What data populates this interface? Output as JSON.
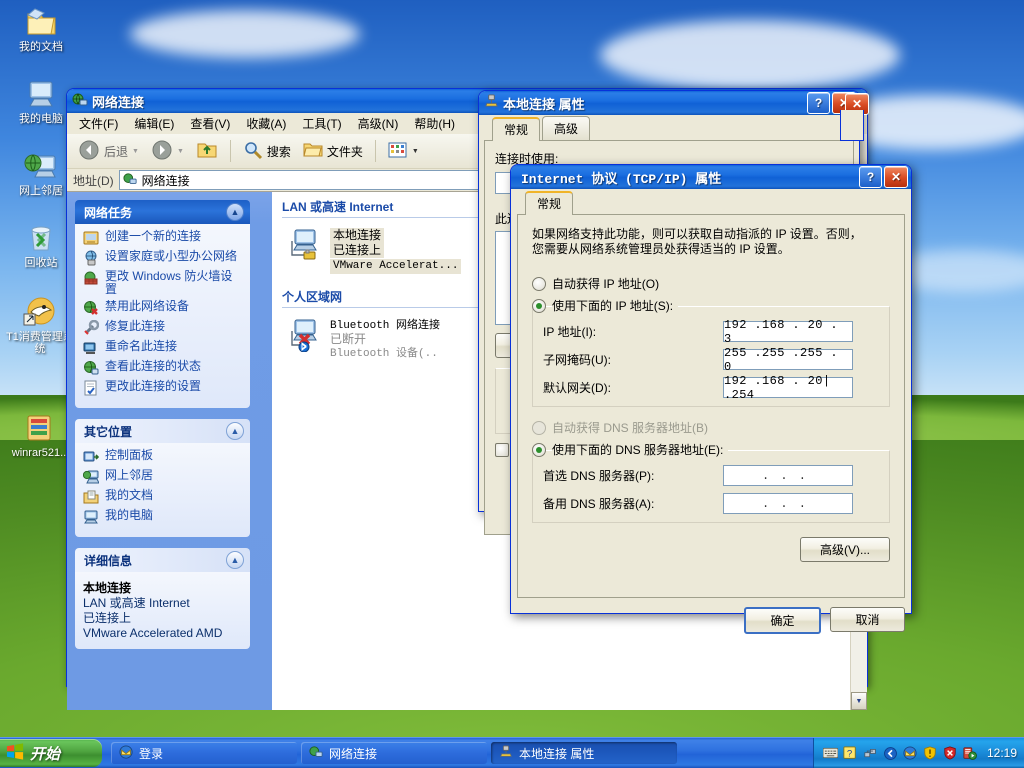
{
  "desktop": {
    "icons": [
      {
        "label": "我的文档",
        "icon": "my-documents-icon"
      },
      {
        "label": "我的电脑",
        "icon": "my-computer-icon"
      },
      {
        "label": "网上邻居",
        "icon": "network-neighborhood-icon"
      },
      {
        "label": "回收站",
        "icon": "recycle-bin-icon"
      },
      {
        "label": "T1消费管理系统",
        "icon": "t1-app-icon"
      },
      {
        "label": "winrar521..",
        "icon": "winrar-icon"
      }
    ]
  },
  "explorer": {
    "title": "网络连接",
    "menus": [
      "文件(F)",
      "编辑(E)",
      "查看(V)",
      "收藏(A)",
      "工具(T)",
      "高级(N)",
      "帮助(H)"
    ],
    "toolbar": {
      "back": "后退",
      "search": "搜索",
      "folders": "文件夹"
    },
    "address": {
      "label": "地址(D)",
      "value": "网络连接"
    },
    "panels": [
      {
        "title": "网络任务",
        "items": [
          {
            "label": "创建一个新的连接",
            "icon": "new-connection-icon"
          },
          {
            "label": "设置家庭或小型办公网络",
            "icon": "home-network-icon"
          },
          {
            "label": "更改 Windows 防火墙设置",
            "icon": "firewall-icon"
          },
          {
            "label": "禁用此网络设备",
            "icon": "disable-device-icon"
          },
          {
            "label": "修复此连接",
            "icon": "repair-icon"
          },
          {
            "label": "重命名此连接",
            "icon": "rename-icon"
          },
          {
            "label": "查看此连接的状态",
            "icon": "status-icon"
          },
          {
            "label": "更改此连接的设置",
            "icon": "settings-icon"
          }
        ]
      },
      {
        "title": "其它位置",
        "items": [
          {
            "label": "控制面板",
            "icon": "control-panel-icon"
          },
          {
            "label": "网上邻居",
            "icon": "network-neighborhood-icon"
          },
          {
            "label": "我的文档",
            "icon": "my-documents-icon"
          },
          {
            "label": "我的电脑",
            "icon": "my-computer-icon"
          }
        ]
      }
    ],
    "details": {
      "title": "详细信息",
      "name": "本地连接",
      "line2": "LAN 或高速 Internet",
      "line3": "已连接上",
      "line4": "VMware Accelerated AMD"
    },
    "groups": [
      {
        "header": "LAN 或高速 Internet",
        "items": [
          {
            "name": "本地连接",
            "status": "已连接上",
            "device": "VMware Accelerat...",
            "selected": true,
            "disconnected": false
          }
        ]
      },
      {
        "header": "个人区域网",
        "items": [
          {
            "name": "Bluetooth 网络连接",
            "status": "已断开",
            "device": "Bluetooth 设备(..",
            "selected": false,
            "disconnected": true
          }
        ]
      }
    ]
  },
  "lan_props": {
    "title": "本地连接 属性",
    "tabs": [
      "常规",
      "高级"
    ],
    "body_label": "连接时使用:"
  },
  "tcpip": {
    "title": "Internet 协议 (TCP/IP) 属性",
    "tab": "常规",
    "description_line1": "如果网络支持此功能，则可以获取自动指派的 IP 设置。否则，",
    "description_line2": "您需要从网络系统管理员处获得适当的 IP 设置。",
    "ip_auto_label": "自动获得 IP 地址(O)",
    "ip_manual_label": "使用下面的 IP 地址(S):",
    "fields": [
      {
        "label": "IP 地址(I):",
        "value": "192 .168 . 20 .  3"
      },
      {
        "label": "子网掩码(U):",
        "value": "255 .255 .255 .  0"
      },
      {
        "label": "默认网关(D):",
        "value": "192 .168 . 20| .254"
      }
    ],
    "dns_auto_label": "自动获得 DNS 服务器地址(B)",
    "dns_manual_label": "使用下面的 DNS 服务器地址(E):",
    "dns_fields": [
      {
        "label": "首选 DNS 服务器(P):",
        "value": ".      .      ."
      },
      {
        "label": "备用 DNS 服务器(A):",
        "value": ".      .      ."
      }
    ],
    "advanced_button": "高级(V)...",
    "ok_button": "确定",
    "cancel_button": "取消"
  },
  "taskbar": {
    "start": "开始",
    "tasks": [
      {
        "label": "登录",
        "icon": "login-icon",
        "active": false
      },
      {
        "label": "网络连接",
        "icon": "network-icon",
        "active": false
      },
      {
        "label": "本地连接 属性",
        "icon": "lan-props-icon",
        "active": true
      }
    ],
    "clock": "12:19"
  },
  "colors": {
    "title_active": "#0f63d9",
    "title_inactive": "#5b97ea",
    "dialog_face": "#ece9d8",
    "panel_blue": "#6e9ae4",
    "link_blue": "#1b4ba8",
    "taskbar_blue": "#2264d8",
    "start_green": "#3d8f30"
  }
}
